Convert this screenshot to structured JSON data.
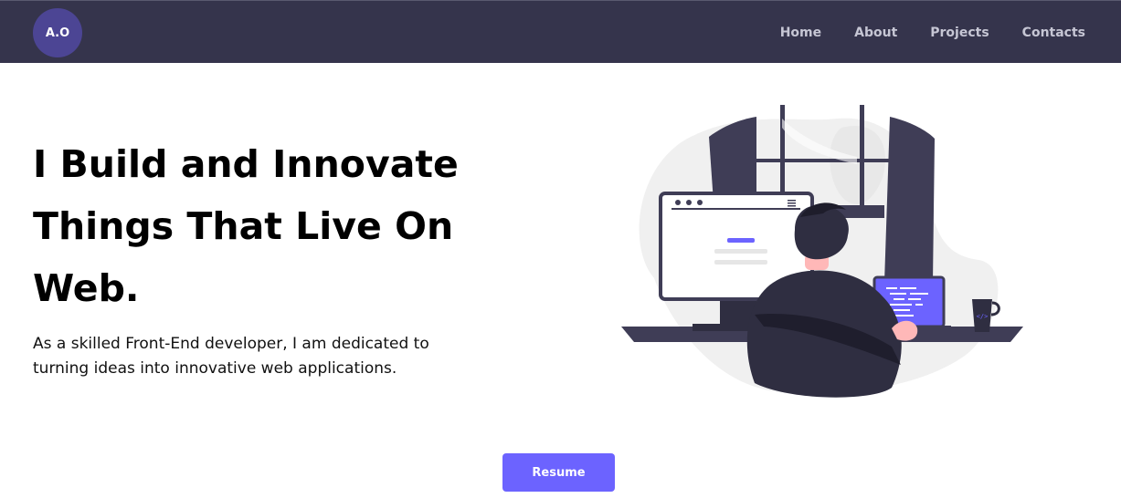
{
  "brand": {
    "logo_text": "A.O",
    "color": "#4c4594"
  },
  "nav": {
    "background": "#35344c",
    "items": [
      {
        "label": "Home"
      },
      {
        "label": "About"
      },
      {
        "label": "Projects"
      },
      {
        "label": "Contacts"
      }
    ]
  },
  "hero": {
    "title_line1": "I Build and Innovate",
    "title_line2": "Things That Live On",
    "title_line3": "Web.",
    "description_line1": "As a skilled Front-End developer, I am dedicated to",
    "description_line2": "turning ideas into innovative web applications.",
    "illustration_icon": "developer-at-desk-illustration"
  },
  "cta": {
    "resume_label": "Resume",
    "color": "#6c63ff"
  }
}
